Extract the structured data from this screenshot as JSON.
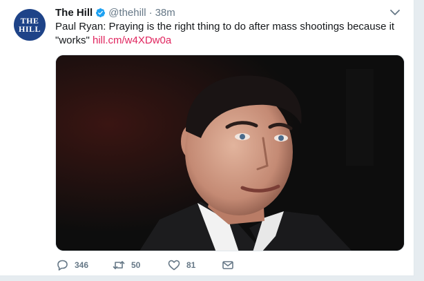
{
  "tweet": {
    "avatar_text_top": "THE",
    "avatar_text_bottom": "HILL",
    "display_name": "The Hill",
    "handle": "@thehill",
    "separator": "·",
    "time": "38m",
    "text": "Paul Ryan: Praying is the right thing to do after mass shootings because it \"works\"",
    "link": "hill.cm/w4XDw0a",
    "media_alt": "Photo of Paul Ryan speaking",
    "replies": "346",
    "retweets": "50",
    "likes": "81"
  },
  "icons": {
    "verified": "verified-badge-icon",
    "menu": "chevron-down-icon",
    "reply": "reply-icon",
    "retweet": "retweet-icon",
    "like": "heart-icon",
    "dm": "envelope-icon"
  },
  "colors": {
    "brand_blue": "#1da1f2",
    "link": "#e0245e",
    "muted": "#657786",
    "avatar_bg": "#1e4388"
  }
}
